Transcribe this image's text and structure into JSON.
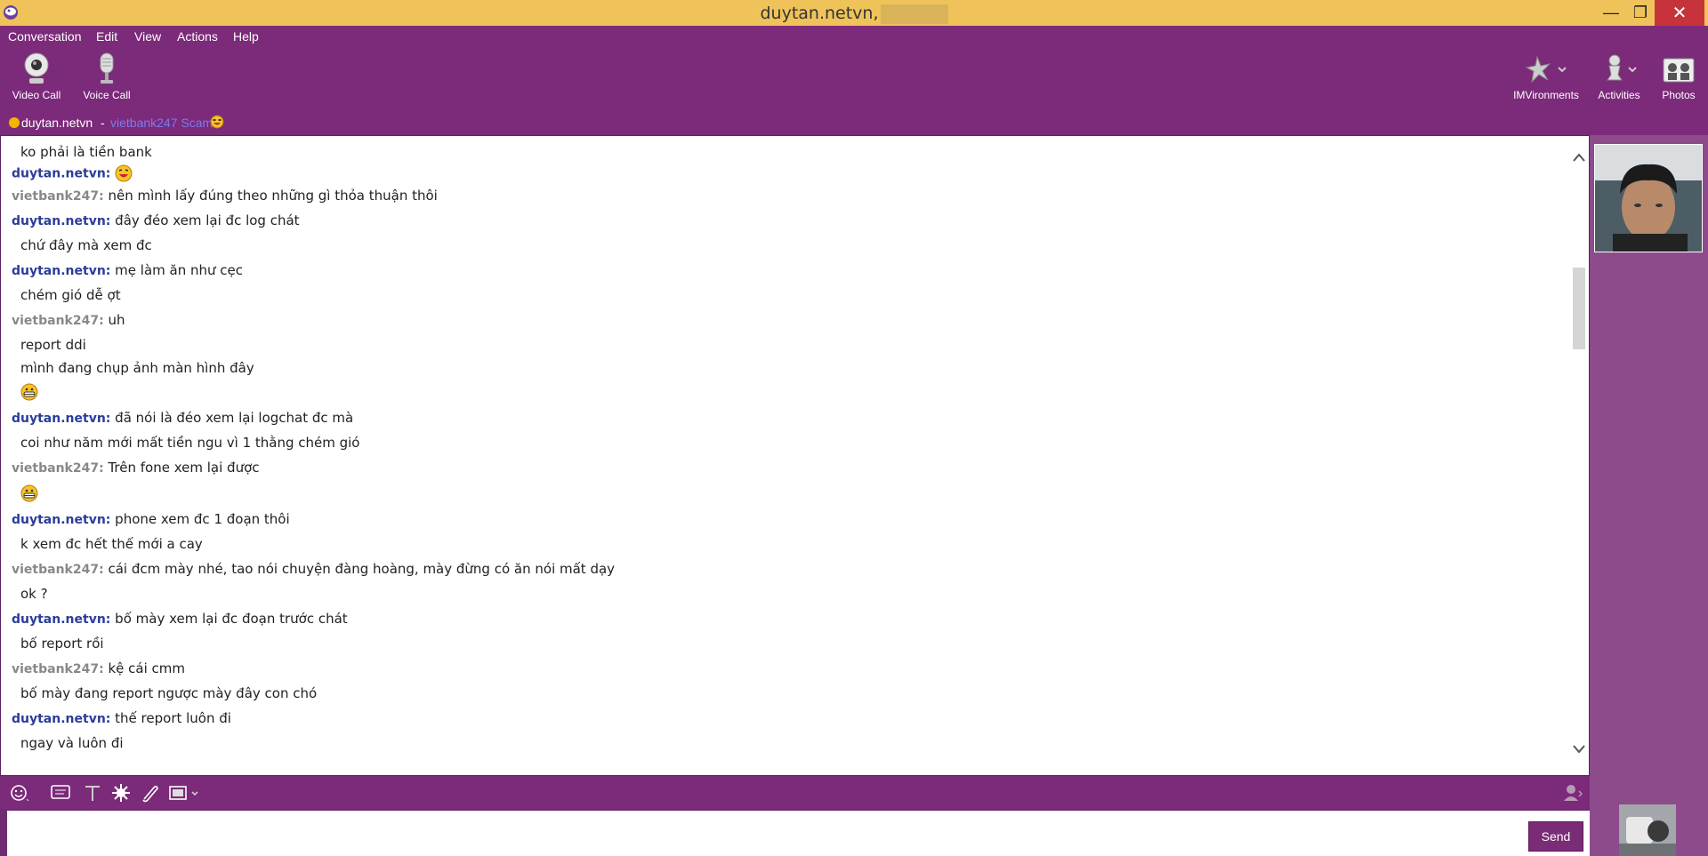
{
  "window": {
    "title": "duytan.netvn,",
    "minimize_glyph": "—",
    "maximize_glyph": "❐",
    "close_glyph": "✕"
  },
  "menu": [
    "Conversation",
    "Edit",
    "View",
    "Actions",
    "Help"
  ],
  "toolbar": {
    "left": [
      {
        "label": "Video Call",
        "icon": "webcam-icon"
      },
      {
        "label": "Voice Call",
        "icon": "microphone-icon"
      }
    ],
    "right": [
      {
        "label": "IMVironments",
        "icon": "imvironments-icon"
      },
      {
        "label": "Activities",
        "icon": "activities-icon"
      },
      {
        "label": "Photos",
        "icon": "photos-icon"
      }
    ]
  },
  "contact": {
    "name": "duytan.netvn",
    "separator": "-",
    "status_message": "vietbank247 Scam",
    "status_color": "#f5b400"
  },
  "messages": [
    {
      "sender": "",
      "text": "ko phải là tiền bank"
    },
    {
      "sender": "duytan.netvn:",
      "text": "",
      "emoji": "laughing-emoji"
    },
    {
      "sender": "vietbank247:",
      "text": "nên mình lấy đúng theo những gì thỏa thuận thôi"
    },
    {
      "sender": "duytan.netvn:",
      "text": "đây đéo xem lại đc log chát"
    },
    {
      "sender": "",
      "text": "chứ đây mà xem đc"
    },
    {
      "sender": "duytan.netvn:",
      "text": "mẹ làm ăn như cẹc"
    },
    {
      "sender": "",
      "text": "chém gió dễ ợt"
    },
    {
      "sender": "vietbank247:",
      "text": "uh"
    },
    {
      "sender": "",
      "text": "report ddi"
    },
    {
      "sender": "",
      "text": "mình đang chụp ảnh màn hình đây"
    },
    {
      "sender": "",
      "text": "",
      "emoji": "grin-emoji"
    },
    {
      "sender": "duytan.netvn:",
      "text": "đã nói là đéo xem lại logchat đc mà"
    },
    {
      "sender": "",
      "text": "coi như năm mới mất tiền ngu vì 1 thằng chém gió"
    },
    {
      "sender": "vietbank247:",
      "text": "Trên fone xem lại được"
    },
    {
      "sender": "",
      "text": "",
      "emoji": "grin-emoji"
    },
    {
      "sender": "duytan.netvn:",
      "text": "phone xem đc 1 đoạn thôi"
    },
    {
      "sender": "",
      "text": "k xem đc hết thế mới a cay"
    },
    {
      "sender": "vietbank247:",
      "text": "cái đcm mày nhé, tao nói chuyện đàng hoàng, mày đừng có ăn nói mất dạy"
    },
    {
      "sender": "",
      "text": "ok ?"
    },
    {
      "sender": "duytan.netvn:",
      "text": "bố mày xem lại đc đoạn trước chát"
    },
    {
      "sender": "",
      "text": "bố report rồi"
    },
    {
      "sender": "vietbank247:",
      "text": "kệ cái cmm"
    },
    {
      "sender": "",
      "text": "bố mày đang report ngược mày đây con chó"
    },
    {
      "sender": "duytan.netvn:",
      "text": "thế report luôn đi"
    },
    {
      "sender": "",
      "text": "ngay và luôn đi"
    }
  ],
  "input": {
    "placeholder": "",
    "value": "",
    "send_label": "Send"
  },
  "input_tools": [
    "emoticons-icon",
    "nudge-icon",
    "text-format-icon",
    "audibles-icon",
    "attach-icon",
    "imvironment-small-icon"
  ]
}
